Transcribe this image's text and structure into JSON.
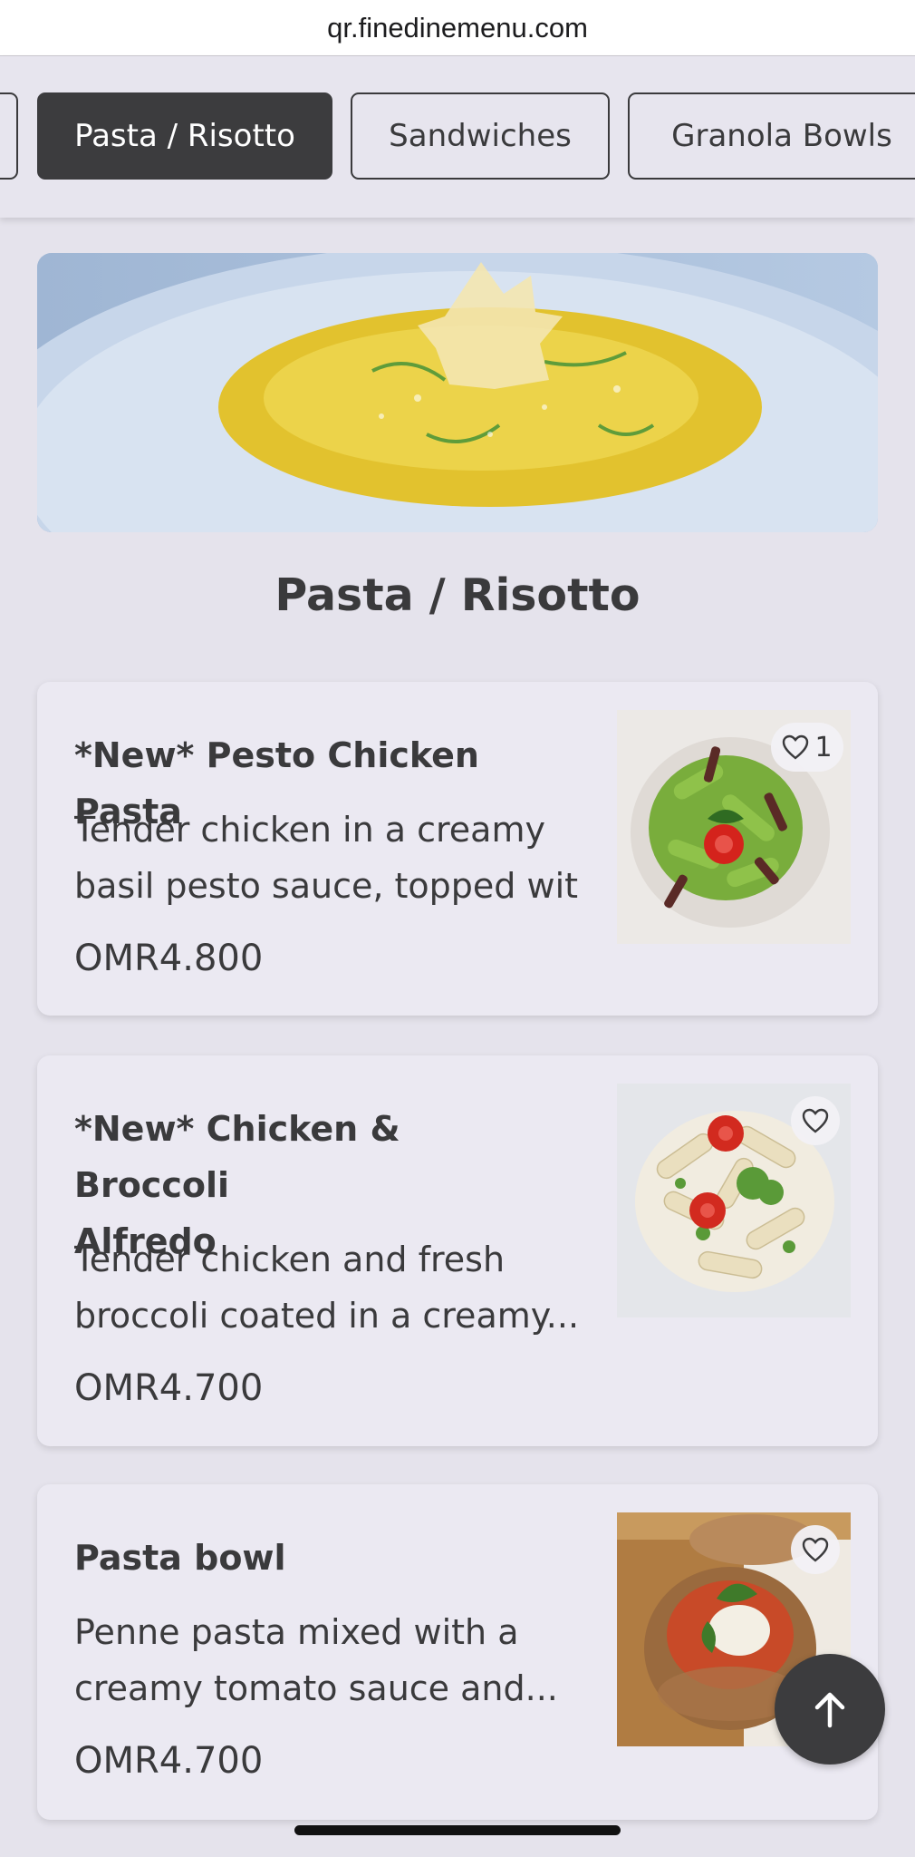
{
  "browser": {
    "url": "qr.finedinemenu.com"
  },
  "tabs": [
    {
      "label": "",
      "active": false
    },
    {
      "label": "Pasta / Risotto",
      "active": true
    },
    {
      "label": "Sandwiches",
      "active": false
    },
    {
      "label": "Granola Bowls",
      "active": false
    }
  ],
  "section": {
    "hero_icon": "risotto-photo",
    "title": "Pasta / Risotto"
  },
  "items": [
    {
      "name_lines": [
        "*New* Pesto Chicken Pasta"
      ],
      "description_lines": [
        "Tender chicken in a creamy",
        "basil pesto sauce, topped wit..."
      ],
      "price": "OMR4.800",
      "likes": "1",
      "image_icon": "pesto-pasta-photo"
    },
    {
      "name_lines": [
        "*New* Chicken & Broccoli",
        "Alfredo"
      ],
      "description_lines": [
        "Tender chicken and fresh",
        "broccoli coated in a creamy..."
      ],
      "price": "OMR4.700",
      "likes": "",
      "image_icon": "alfredo-pasta-photo"
    },
    {
      "name_lines": [
        "Pasta bowl"
      ],
      "description_lines": [
        "Penne pasta mixed with a",
        "creamy tomato sauce and..."
      ],
      "price": "OMR4.700",
      "likes": "",
      "image_icon": "pasta-bread-bowl-photo"
    }
  ],
  "controls": {
    "scroll_top_icon": "arrow-up-icon",
    "like_icon": "heart-outline-icon"
  },
  "colors": {
    "active_tab": "#3c3c3e",
    "background": "#e5e3ec",
    "card": "#ebe9f2",
    "text": "#3a3a3c"
  }
}
